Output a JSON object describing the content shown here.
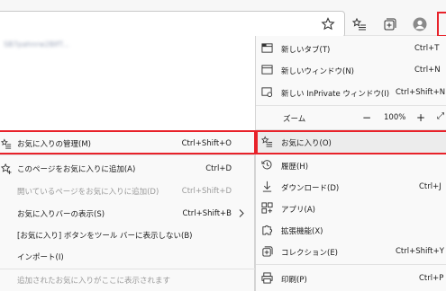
{
  "browser": {
    "url_blur": "SB7pahnrw2BlfT...",
    "icons": [
      "star-add-icon",
      "favorites-list-icon",
      "collections-icon",
      "profile-icon"
    ]
  },
  "main_menu": {
    "new_tab": {
      "label": "新しいタブ(T)",
      "shortcut": "Ctrl+T"
    },
    "new_window": {
      "label": "新しいウィンドウ(N)",
      "shortcut": "Ctrl+N"
    },
    "new_inprivate": {
      "label": "新しい InPrivate ウィンドウ(I)",
      "shortcut": "Ctrl+Shift+N"
    },
    "zoom": {
      "label": "ズーム",
      "minus": "−",
      "value": "100%",
      "plus": "+"
    },
    "favorites": {
      "label": "お気に入り(O)"
    },
    "history": {
      "label": "履歴(H)"
    },
    "downloads": {
      "label": "ダウンロード(D)",
      "shortcut": "Ctrl+J"
    },
    "apps": {
      "label": "アプリ(A)"
    },
    "extensions": {
      "label": "拡張機能(X)"
    },
    "collections": {
      "label": "コレクション(E)",
      "shortcut": "Ctrl+Shift+Y"
    },
    "print": {
      "label": "印刷(P)",
      "shortcut": "Ctrl+P"
    }
  },
  "favorites_menu": {
    "manage": {
      "label": "お気に入りの管理(M)",
      "shortcut": "Ctrl+Shift+O"
    },
    "add_page": {
      "label": "このページをお気に入りに追加(A)",
      "shortcut": "Ctrl+D"
    },
    "add_open_pages": {
      "label": "開いているページをお気に入りに追加(D)",
      "shortcut": "Ctrl+Shift+D"
    },
    "show_bar": {
      "label": "お気に入りバーの表示(S)",
      "shortcut": "Ctrl+Shift+B"
    },
    "hide_button": {
      "label": "[お気に入り] ボタンをツール バーに表示しない(B)"
    },
    "import": {
      "label": "インポート(I)"
    },
    "empty_note": "追加されたお気に入りがここに表示されます"
  },
  "colors": {
    "highlight_box": "#e8222a"
  }
}
